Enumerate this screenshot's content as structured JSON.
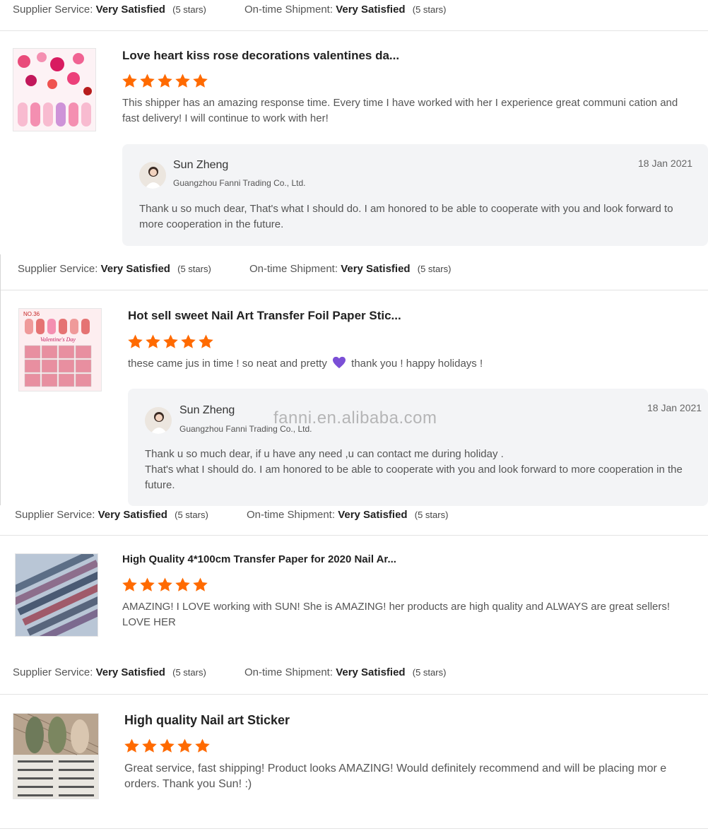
{
  "labels": {
    "supplier_service": "Supplier Service:",
    "ontime_shipment": "On-time Shipment:",
    "very_satisfied": "Very Satisfied",
    "five_stars": "(5 stars)"
  },
  "reviews": [
    {
      "title": "Love heart kiss rose decorations valentines da...",
      "stars": 5,
      "text": "This shipper has an amazing response time. Every time I have worked with her I experience great communi cation and fast delivery! I will continue to work with her!",
      "reply": {
        "name": "Sun Zheng",
        "company": "Guangzhou Fanni Trading Co., Ltd.",
        "date": "18 Jan 2021",
        "text": "Thank u so much dear, That's what I should do. I am honored to be able to cooperate with you and look forward to more cooperation in the future."
      }
    },
    {
      "title": "Hot sell sweet Nail Art Transfer Foil Paper Stic...",
      "stars": 5,
      "text": "these came jus in time ! so neat and pretty",
      "text_after": "thank you ! happy holidays !",
      "thumb_label_1": "NO.36",
      "thumb_label_2": "Valentine's Day",
      "reply": {
        "name": "Sun Zheng",
        "company": "Guangzhou Fanni Trading Co., Ltd.",
        "date": "18 Jan 2021",
        "text_line1": "Thank u so much dear, if u have any need ,u can contact me during holiday .",
        "text_line2": "That's what I should do. I am honored to be able to cooperate with you and look forward to more cooperation in the future."
      }
    },
    {
      "title": "High Quality 4*100cm Transfer Paper for 2020 Nail Ar...",
      "stars": 5,
      "text": "AMAZING! I LOVE working with SUN! She is AMAZING! her products are high quality and ALWAYS are great sellers! LOVE HER"
    },
    {
      "title": "High quality Nail art Sticker",
      "stars": 5,
      "text": "Great service, fast shipping! Product looks AMAZING! Would definitely recommend and will be placing mor e orders. Thank you Sun! :)"
    }
  ],
  "watermark": "fanni.en.alibaba.com",
  "colors": {
    "star": "#ff6a00",
    "heart": "#7b4fd6",
    "reply_bg": "#f3f4f6"
  }
}
